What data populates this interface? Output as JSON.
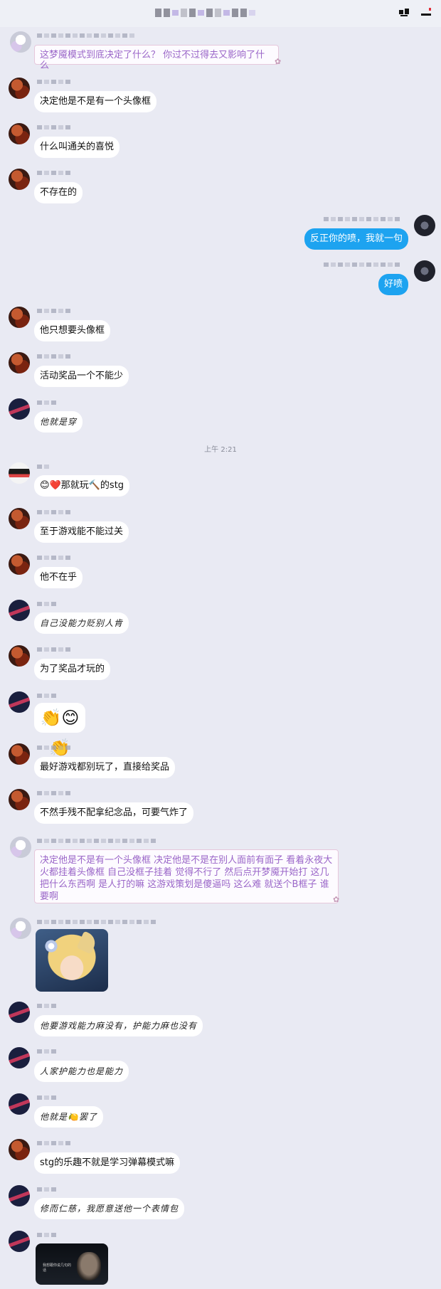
{
  "time_separator": "上午 2:21",
  "messages": [
    {
      "side": "left",
      "avatar": "ghost-avatar",
      "type": "fancy",
      "text": "这梦魇模式到底决定了什么？ 你过不过得去又影响了什么"
    },
    {
      "side": "left",
      "avatar": "red-avatar",
      "type": "text",
      "text": "决定他是不是有一个头像框"
    },
    {
      "side": "left",
      "avatar": "red-avatar",
      "type": "text",
      "text": "什么叫通关的喜悦"
    },
    {
      "side": "left",
      "avatar": "red-avatar",
      "type": "text",
      "text": "不存在的"
    },
    {
      "side": "right",
      "avatar": "dark-avatar",
      "type": "text",
      "text": "反正你的喷，我就一句"
    },
    {
      "side": "right",
      "avatar": "dark-avatar",
      "type": "text",
      "text": "好喷"
    },
    {
      "side": "left",
      "avatar": "red-avatar",
      "type": "text",
      "text": "他只想要头像框"
    },
    {
      "side": "left",
      "avatar": "red-avatar",
      "type": "text",
      "text": "活动奖品一个不能少"
    },
    {
      "side": "left",
      "avatar": "navy-avatar",
      "type": "hand",
      "text": "他就是穿"
    },
    {
      "side": "left",
      "avatar": "flag-avatar",
      "type": "text",
      "text": "😊❤️那就玩🔨的stg"
    },
    {
      "side": "left",
      "avatar": "red-avatar",
      "type": "text",
      "text": "至于游戏能不能过关"
    },
    {
      "side": "left",
      "avatar": "red-avatar",
      "type": "text",
      "text": "他不在乎"
    },
    {
      "side": "left",
      "avatar": "navy-avatar",
      "type": "hand",
      "text": "自己没能力贬别人肯"
    },
    {
      "side": "left",
      "avatar": "red-avatar",
      "type": "text",
      "text": "为了奖品才玩的"
    },
    {
      "side": "left",
      "avatar": "navy-avatar",
      "type": "sticker",
      "text": "👏😊👏"
    },
    {
      "side": "left",
      "avatar": "red-avatar",
      "type": "text",
      "text": "最好游戏都别玩了，直接给奖品"
    },
    {
      "side": "left",
      "avatar": "red-avatar",
      "type": "text",
      "text": "不然手残不配拿纪念品，可要气炸了"
    },
    {
      "side": "left",
      "avatar": "ghost-avatar",
      "type": "fancy",
      "text": "决定他是不是有一个头像框 决定他是不是在别人面前有面子 看着永夜大火都挂着头像框 自己没框子挂着 觉得不行了 然后点开梦魇开始打 这几把什么东西啊 是人打的嘛 这游戏策划是傻逼吗 这么难 就送个B框子 谁要啊"
    },
    {
      "side": "left",
      "avatar": "ghost-avatar",
      "type": "image-anime",
      "text": ""
    },
    {
      "side": "left",
      "avatar": "navy-avatar",
      "type": "hand",
      "text": "他要游戏能力麻没有，护能力麻也没有"
    },
    {
      "side": "left",
      "avatar": "navy-avatar",
      "type": "hand",
      "text": "人家护能力也是能力"
    },
    {
      "side": "left",
      "avatar": "navy-avatar",
      "type": "hand",
      "text": "他就是🍋罢了"
    },
    {
      "side": "left",
      "avatar": "red-avatar",
      "type": "text",
      "text": "stg的乐趣不就是学习弹幕模式嘛"
    },
    {
      "side": "left",
      "avatar": "navy-avatar",
      "type": "hand",
      "text": "修而仁慈，我愿意送他一个表情包"
    },
    {
      "side": "left",
      "avatar": "navy-avatar",
      "type": "image-movie",
      "text": ""
    }
  ],
  "movie_caption": "我想跟你说几句的话"
}
